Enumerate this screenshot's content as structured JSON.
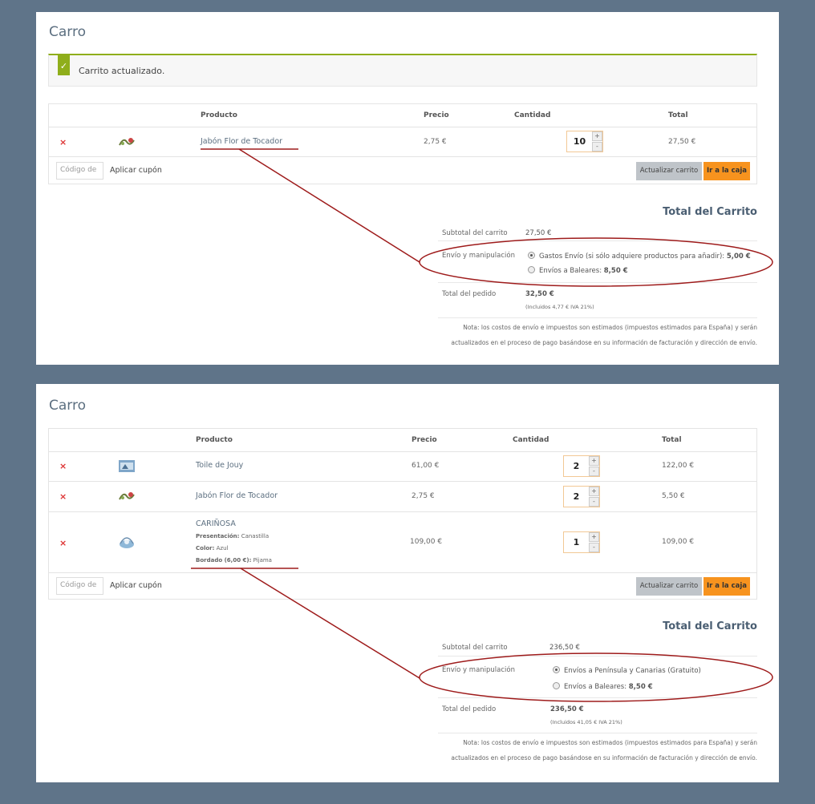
{
  "colors": {
    "annotation": "#9e1b1b",
    "checkout": "#f7931e",
    "success": "#8fae1b"
  },
  "panel1": {
    "title": "Carro",
    "notice": "Carrito actualizado.",
    "headers": {
      "product": "Producto",
      "price": "Precio",
      "qty": "Cantidad",
      "total": "Total"
    },
    "items": [
      {
        "name": "Jabón Flor de Tocador",
        "price": "2,75 €",
        "qty": "10",
        "total": "27,50 €"
      }
    ],
    "coupon_placeholder": "Código de",
    "apply_label": "Aplicar cupón",
    "update_label": "Actualizar carrito",
    "checkout_label": "Ir a la caja",
    "totals": {
      "title": "Total del Carrito",
      "subtotal_label": "Subtotal del carrito",
      "subtotal_value": "27,50 €",
      "shipping_label": "Envío y manipulación",
      "option1": "Gastos Envío (si sólo adquiere productos para añadir):",
      "option1_price": "5,00 €",
      "option2": "Envíos a Baleares:",
      "option2_price": "8,50 €",
      "order_total_label": "Total del pedido",
      "order_total_value": "32,50 €",
      "tax_note": "(Incluidos 4,77 € IVA 21%)",
      "note": "Nota: los costos de envío e impuestos son estimados (impuestos estimados para España) y serán actualizados en el proceso de pago basándose en su información de facturación y dirección de envío."
    }
  },
  "panel2": {
    "title": "Carro",
    "headers": {
      "product": "Producto",
      "price": "Precio",
      "qty": "Cantidad",
      "total": "Total"
    },
    "items": [
      {
        "name": "Toile de Jouy",
        "price": "61,00 €",
        "qty": "2",
        "total": "122,00 €"
      },
      {
        "name": "Jabón Flor de Tocador",
        "price": "2,75 €",
        "qty": "2",
        "total": "5,50 €"
      },
      {
        "name": "CARIÑOSA",
        "price": "109,00 €",
        "qty": "1",
        "total": "109,00 €",
        "attr1_label": "Presentación:",
        "attr1_value": "Canastilla",
        "attr2_label": "Color:",
        "attr2_value": "Azul",
        "attr3_label": "Bordado (6,00 €):",
        "attr3_value": "Pijama"
      }
    ],
    "coupon_placeholder": "Código de",
    "apply_label": "Aplicar cupón",
    "update_label": "Actualizar carrito",
    "checkout_label": "Ir a la caja",
    "totals": {
      "title": "Total del Carrito",
      "subtotal_label": "Subtotal del carrito",
      "subtotal_value": "236,50 €",
      "shipping_label": "Envío y manipulación",
      "option1": "Envíos a Península y Canarias (Gratuito)",
      "option2": "Envíos a Baleares:",
      "option2_price": "8,50 €",
      "order_total_label": "Total del pedido",
      "order_total_value": "236,50 €",
      "tax_note": "(Incluidos 41,05 € IVA 21%)",
      "note": "Nota: los costos de envío e impuestos son estimados (impuestos estimados para España) y serán actualizados en el proceso de pago basándose en su información de facturación y dirección de envío."
    }
  }
}
